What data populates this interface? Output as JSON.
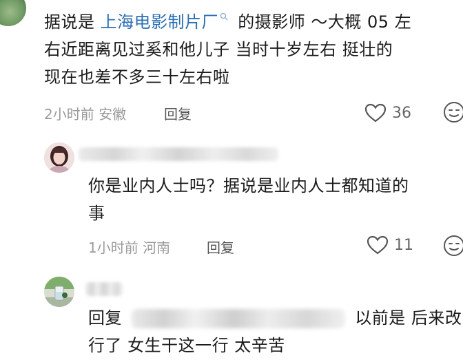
{
  "comment1": {
    "text_pre": "据说是 ",
    "link_text": "上海电影制片厂",
    "line1_post": " 的摄影师 ～大概 05 左",
    "line2": "右近距离见过奚和他儿子 当时十岁左右 挺壮的",
    "line3": "现在也差不多三十左右啦",
    "meta": "2小时前  安徽",
    "reply_label": "回复",
    "likes": "36"
  },
  "comment2": {
    "line1": "你是业内人士吗？据说是业内人士都知道的",
    "line2": "事",
    "meta": "1小时前  河南",
    "reply_label": "回复",
    "likes": "11"
  },
  "comment3": {
    "reply_prefix": "回复",
    "line1_post": "以前是  后来改",
    "line2": "行了  女生干这一行 太辛苦"
  },
  "icons": {
    "heart": "heart-icon",
    "emoji": "emoji-icon",
    "search": "search-icon"
  }
}
